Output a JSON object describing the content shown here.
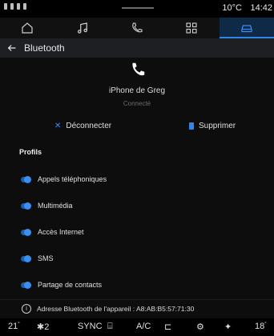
{
  "status": {
    "temperature": "10°C",
    "clock": "14:42"
  },
  "nav": {
    "items": [
      {
        "name": "home-icon",
        "label": "Accueil"
      },
      {
        "name": "music-icon",
        "label": "Multimédia"
      },
      {
        "name": "phone-icon",
        "label": "Téléphone"
      },
      {
        "name": "apps-icon",
        "label": "Applications"
      },
      {
        "name": "car-icon",
        "label": "Véhicule",
        "active": true
      }
    ]
  },
  "header": {
    "title": "Bluetooth"
  },
  "device": {
    "name": "iPhone de Greg",
    "status": "Connecté"
  },
  "actions": {
    "disconnect": "Déconnecter",
    "delete": "Supprimer"
  },
  "profiles": {
    "title": "Profils",
    "items": [
      {
        "label": "Appels téléphoniques",
        "enabled": true
      },
      {
        "label": "Multimédia",
        "enabled": true
      },
      {
        "label": "Accès Internet",
        "enabled": true
      },
      {
        "label": "SMS",
        "enabled": true
      },
      {
        "label": "Partage de contacts",
        "enabled": true
      }
    ]
  },
  "info": {
    "text": "Adresse Bluetooth de l'appareil : A8:AB:B5:57:71:30"
  },
  "climate": {
    "temp_left": "21",
    "seat_level": "2",
    "sync": "SYNC",
    "ac": "A/C",
    "temp_right": "18"
  },
  "colors": {
    "accent": "#2f86e6",
    "background": "#0d0d0d"
  }
}
